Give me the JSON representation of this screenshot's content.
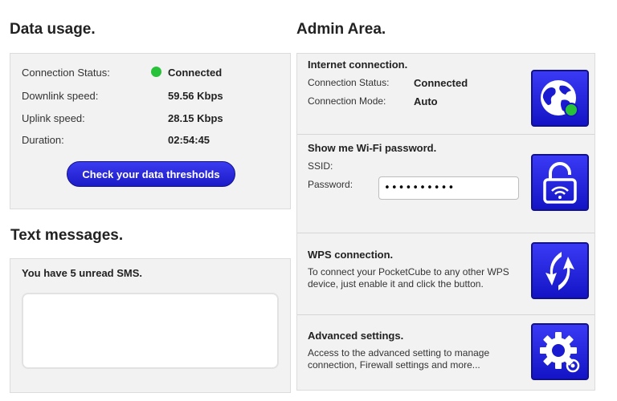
{
  "data_usage": {
    "title": "Data usage.",
    "rows": [
      {
        "label": "Connection Status:",
        "value": "Connected"
      },
      {
        "label": "Downlink speed:",
        "value": "59.56 Kbps"
      },
      {
        "label": "Uplink speed:",
        "value": "28.15 Kbps"
      },
      {
        "label": "Duration:",
        "value": "02:54:45"
      }
    ],
    "status_color": "#27c23a",
    "button": "Check your data thresholds"
  },
  "text_messages": {
    "title": "Text messages.",
    "unread": "You have 5 unread SMS."
  },
  "admin": {
    "title": "Admin Area.",
    "internet": {
      "title": "Internet connection.",
      "status_label": "Connection Status:",
      "status_value": "Connected",
      "mode_label": "Connection Mode:",
      "mode_value": "Auto",
      "icon": "globe-icon"
    },
    "wifi": {
      "title": "Show me Wi-Fi password.",
      "ssid_label": "SSID:",
      "password_label": "Password:",
      "password_value": "••••••••••",
      "icon": "unlock-wifi-icon"
    },
    "wps": {
      "title": "WPS connection.",
      "text": "To connect your PocketCube to any other WPS device, just enable it and click the button.",
      "icon": "wps-arrows-icon"
    },
    "advanced": {
      "title": "Advanced settings.",
      "text": "Access to the advanced setting to manage connection, Firewall settings and more...",
      "icon": "gear-icon"
    }
  },
  "accent_color": "#2222dd"
}
